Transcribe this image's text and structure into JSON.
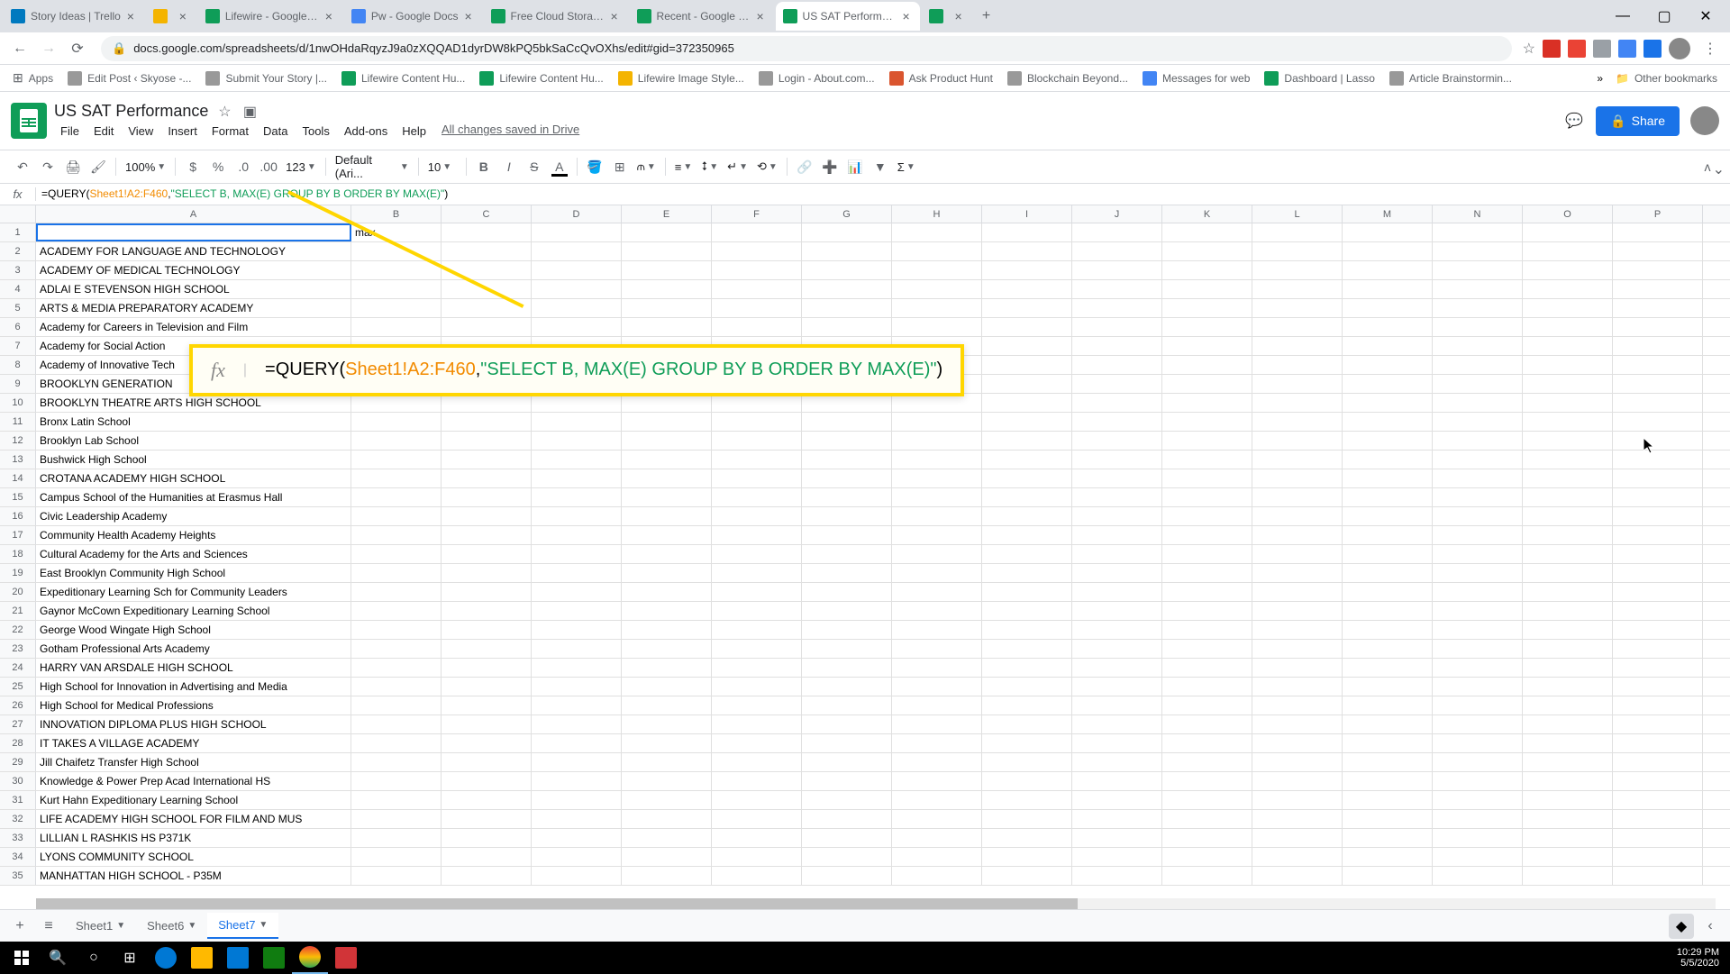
{
  "browser": {
    "tabs": [
      {
        "title": "Story Ideas | Trello",
        "icon_color": "#0079bf"
      },
      {
        "title": "",
        "icon_color": "#f4b400"
      },
      {
        "title": "Lifewire - Google Drive",
        "icon_color": "#0f9d58"
      },
      {
        "title": "Pw - Google Docs",
        "icon_color": "#4285f4"
      },
      {
        "title": "Free Cloud Storage for Pers",
        "icon_color": "#0f9d58"
      },
      {
        "title": "Recent - Google Drive",
        "icon_color": "#0f9d58"
      },
      {
        "title": "US SAT Performance - Goo",
        "icon_color": "#0f9d58",
        "active": true
      },
      {
        "title": "",
        "icon_color": "#0f9d58"
      }
    ],
    "url": "docs.google.com/spreadsheets/d/1nwOHdaRqyzJ9a0zXQQAD1dyrDW8kPQ5bkSaCcQvOXhs/edit#gid=372350965"
  },
  "bookmarks": [
    {
      "label": "Apps",
      "color": "#5f6368"
    },
    {
      "label": "Edit Post ‹ Skyose -...",
      "color": "#999"
    },
    {
      "label": "Submit Your Story |...",
      "color": "#999"
    },
    {
      "label": "Lifewire Content Hu...",
      "color": "#0f9d58"
    },
    {
      "label": "Lifewire Content Hu...",
      "color": "#0f9d58"
    },
    {
      "label": "Lifewire Image Style...",
      "color": "#f4b400"
    },
    {
      "label": "Login - About.com...",
      "color": "#999"
    },
    {
      "label": "Ask Product Hunt",
      "color": "#da552f"
    },
    {
      "label": "Blockchain Beyond...",
      "color": "#999"
    },
    {
      "label": "Messages for web",
      "color": "#4285f4"
    },
    {
      "label": "Dashboard | Lasso",
      "color": "#0f9d58"
    },
    {
      "label": "Article Brainstormin...",
      "color": "#999"
    }
  ],
  "other_bookmarks": "Other bookmarks",
  "doc": {
    "title": "US SAT Performance",
    "menus": [
      "File",
      "Edit",
      "View",
      "Insert",
      "Format",
      "Data",
      "Tools",
      "Add-ons",
      "Help"
    ],
    "saved": "All changes saved in Drive",
    "share": "Share"
  },
  "toolbar": {
    "zoom": "100%",
    "font": "Default (Ari...",
    "size": "10",
    "fmt123": "123"
  },
  "formula": {
    "prefix": "=QUERY(",
    "range": "Sheet1!A2:F460",
    "sep": ",",
    "query": "\"SELECT B, MAX(E) GROUP BY B ORDER BY MAX(E)\"",
    "suffix": ")"
  },
  "columns": [
    "A",
    "B",
    "C",
    "D",
    "E",
    "F",
    "G",
    "H",
    "I",
    "J",
    "K",
    "L",
    "M",
    "N",
    "O",
    "P"
  ],
  "b1_value": "max",
  "rows": [
    {
      "n": 1,
      "a": ""
    },
    {
      "n": 2,
      "a": "ACADEMY FOR LANGUAGE AND TECHNOLOGY"
    },
    {
      "n": 3,
      "a": "ACADEMY OF MEDICAL TECHNOLOGY"
    },
    {
      "n": 4,
      "a": "ADLAI E STEVENSON HIGH SCHOOL"
    },
    {
      "n": 5,
      "a": "ARTS & MEDIA PREPARATORY ACADEMY"
    },
    {
      "n": 6,
      "a": "Academy for Careers in Television and Film"
    },
    {
      "n": 7,
      "a": "Academy for Social Action"
    },
    {
      "n": 8,
      "a": "Academy of Innovative Tech"
    },
    {
      "n": 9,
      "a": "BROOKLYN GENERATION"
    },
    {
      "n": 10,
      "a": "BROOKLYN THEATRE ARTS HIGH SCHOOL"
    },
    {
      "n": 11,
      "a": "Bronx Latin School"
    },
    {
      "n": 12,
      "a": "Brooklyn Lab School"
    },
    {
      "n": 13,
      "a": "Bushwick High School"
    },
    {
      "n": 14,
      "a": "CROTANA ACADEMY HIGH SCHOOL"
    },
    {
      "n": 15,
      "a": "Campus School of the Humanities at Erasmus Hall"
    },
    {
      "n": 16,
      "a": "Civic Leadership Academy"
    },
    {
      "n": 17,
      "a": "Community Health Academy Heights"
    },
    {
      "n": 18,
      "a": "Cultural Academy for the Arts and Sciences"
    },
    {
      "n": 19,
      "a": "East Brooklyn Community High School"
    },
    {
      "n": 20,
      "a": "Expeditionary Learning Sch for Community Leaders"
    },
    {
      "n": 21,
      "a": "Gaynor McCown Expeditionary Learning School"
    },
    {
      "n": 22,
      "a": "George Wood Wingate High School"
    },
    {
      "n": 23,
      "a": "Gotham Professional Arts Academy"
    },
    {
      "n": 24,
      "a": "HARRY VAN ARSDALE HIGH SCHOOL"
    },
    {
      "n": 25,
      "a": "High School for Innovation in Advertising and Media"
    },
    {
      "n": 26,
      "a": "High School for Medical Professions"
    },
    {
      "n": 27,
      "a": "INNOVATION DIPLOMA PLUS HIGH SCHOOL"
    },
    {
      "n": 28,
      "a": "IT TAKES A VILLAGE ACADEMY"
    },
    {
      "n": 29,
      "a": "Jill Chaifetz Transfer High School"
    },
    {
      "n": 30,
      "a": "Knowledge & Power Prep Acad International HS"
    },
    {
      "n": 31,
      "a": "Kurt Hahn Expeditionary Learning School"
    },
    {
      "n": 32,
      "a": "LIFE ACADEMY HIGH SCHOOL FOR FILM AND MUS"
    },
    {
      "n": 33,
      "a": "LILLIAN L RASHKIS HS P371K"
    },
    {
      "n": 34,
      "a": "LYONS COMMUNITY SCHOOL"
    },
    {
      "n": 35,
      "a": "MANHATTAN HIGH SCHOOL - P35M"
    }
  ],
  "sheets": [
    {
      "name": "Sheet1"
    },
    {
      "name": "Sheet6"
    },
    {
      "name": "Sheet7",
      "active": true
    }
  ],
  "callout": {
    "prefix": "=QUERY(",
    "range": "Sheet1!A2:F460",
    "sep": ",",
    "query": "\"SELECT B, MAX(E) GROUP BY B ORDER BY MAX(E)\"",
    "suffix": ")"
  },
  "clock": {
    "time": "10:29 PM",
    "date": "5/5/2020"
  }
}
